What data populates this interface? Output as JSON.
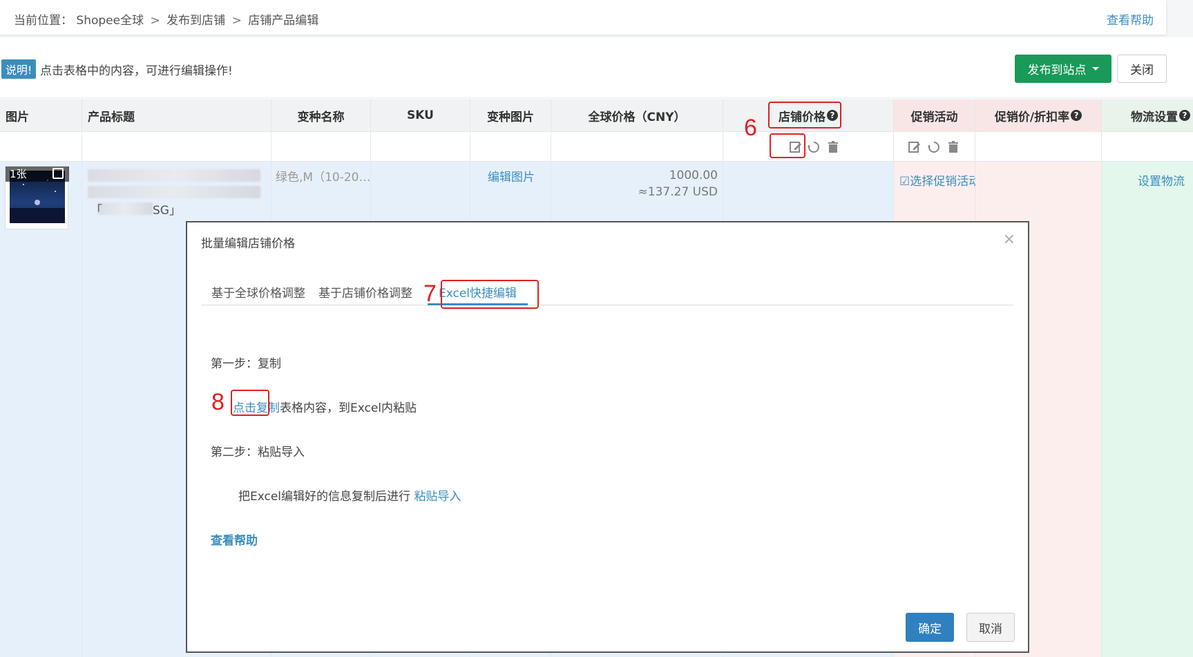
{
  "breadcrumb": {
    "prefix": "当前位置：",
    "items": [
      "Shopee全球",
      "发布到店铺",
      "店铺产品编辑"
    ],
    "sep": ">"
  },
  "help_link": "查看帮助",
  "info": {
    "badge": "说明!",
    "text": "点击表格中的内容，可进行编辑操作!"
  },
  "actions": {
    "publish_label": "发布到站点",
    "close_label": "关闭"
  },
  "table": {
    "headers": {
      "image": "图片",
      "title": "产品标题",
      "variant_name": "变种名称",
      "sku": "SKU",
      "variant_image": "变种图片",
      "global_price": "全球价格（CNY）",
      "shop_price": "店铺价格",
      "promotion": "促销活动",
      "promo_price": "促销价/折扣率",
      "logistics": "物流设置"
    },
    "row": {
      "image_count": "1张",
      "title_suffix": "SG",
      "title_open": "「",
      "title_close": "」",
      "variant": "绿色,M（10-20…",
      "edit_image": "编辑图片",
      "price_cny": "1000.00",
      "price_usd": "≈137.27 USD",
      "select_promo": "选择促销活动",
      "set_logistics": "设置物流"
    }
  },
  "annotations": {
    "six": "6",
    "seven": "7",
    "eight": "8"
  },
  "modal": {
    "title": "批量编辑店铺价格",
    "close": "×",
    "tabs": [
      "基于全球价格调整",
      "基于店铺价格调整",
      "Excel快捷编辑"
    ],
    "step1": "第一步：复制",
    "copy_link": "点击复制",
    "copy_rest": "表格内容，到Excel内粘贴",
    "step2": "第二步：粘贴导入",
    "paste_text": "把Excel编辑好的信息复制后进行",
    "paste_link": "粘贴导入",
    "help": "查看帮助",
    "ok": "确定",
    "cancel": "取消"
  }
}
